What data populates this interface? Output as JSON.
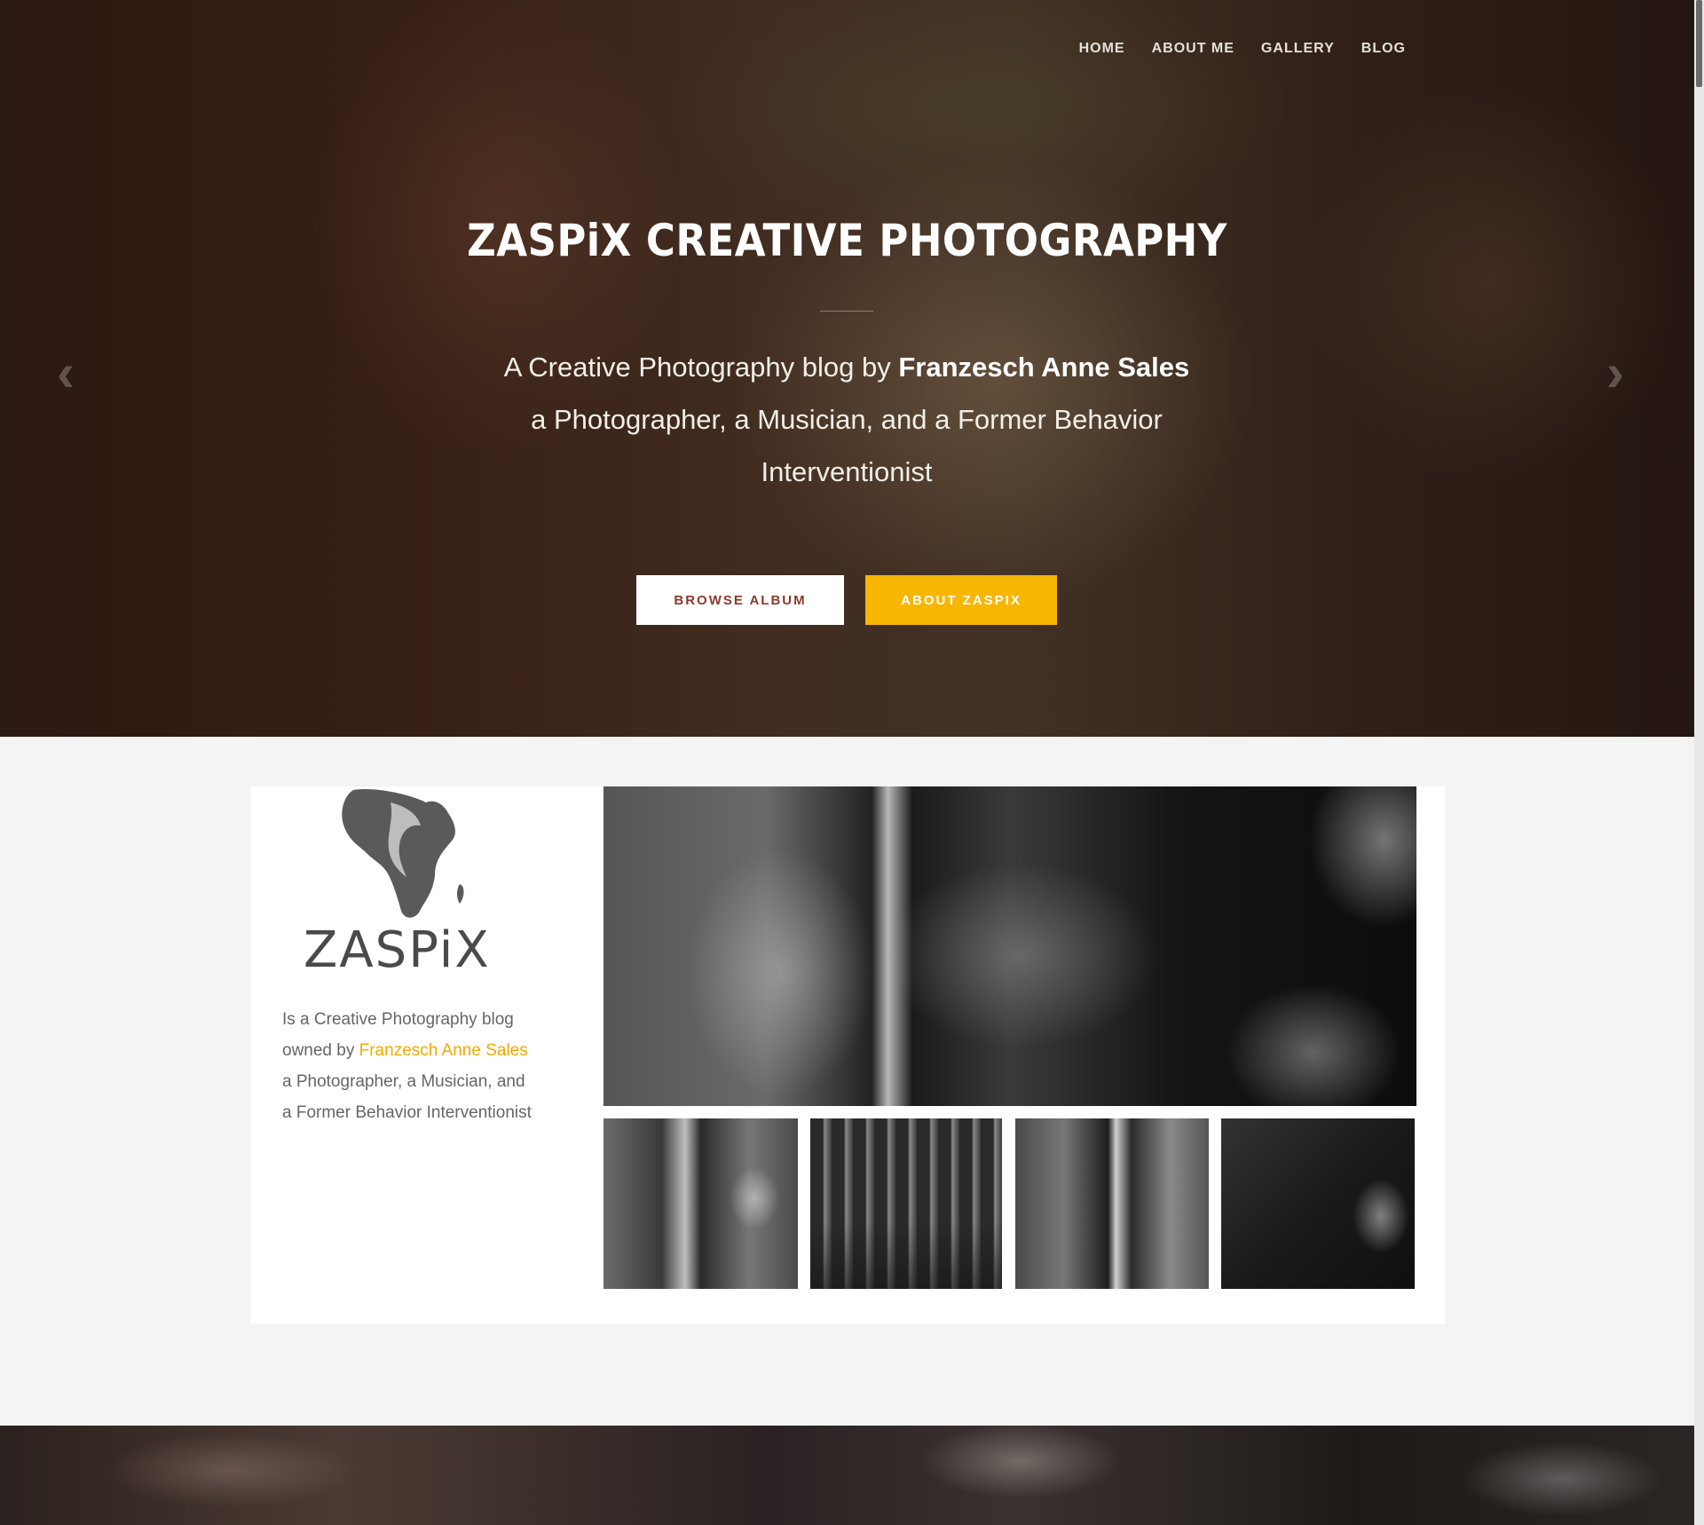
{
  "nav": {
    "items": [
      {
        "label": "HOME"
      },
      {
        "label": "ABOUT ME"
      },
      {
        "label": "GALLERY"
      },
      {
        "label": "BLOG"
      }
    ]
  },
  "hero": {
    "title": "ZASPiX CREATIVE PHOTOGRAPHY",
    "subtitle_prefix": "A Creative Photography blog by ",
    "subtitle_name": "Franzesch Anne Sales",
    "subtitle_line2": "a Photographer, a Musician, and a Former Behavior",
    "subtitle_line3": "Interventionist",
    "buttons": {
      "browse": "BROWSE ALBUM",
      "about": "ABOUT ZASPIX"
    },
    "arrow_prev": "‹",
    "arrow_next": "›"
  },
  "about_card": {
    "logo_text": "ZASPiX",
    "text_line1": "Is a Creative Photography blog",
    "text_owned_by": "owned by ",
    "owner_name": "Franzesch Anne Sales",
    "text_line3": "a Photographer, a Musician, and",
    "text_line4": "a Former Behavior Interventionist"
  },
  "colors": {
    "accent": "#f7b602",
    "link": "#f2a900",
    "browse_text": "#8b3a2a"
  }
}
